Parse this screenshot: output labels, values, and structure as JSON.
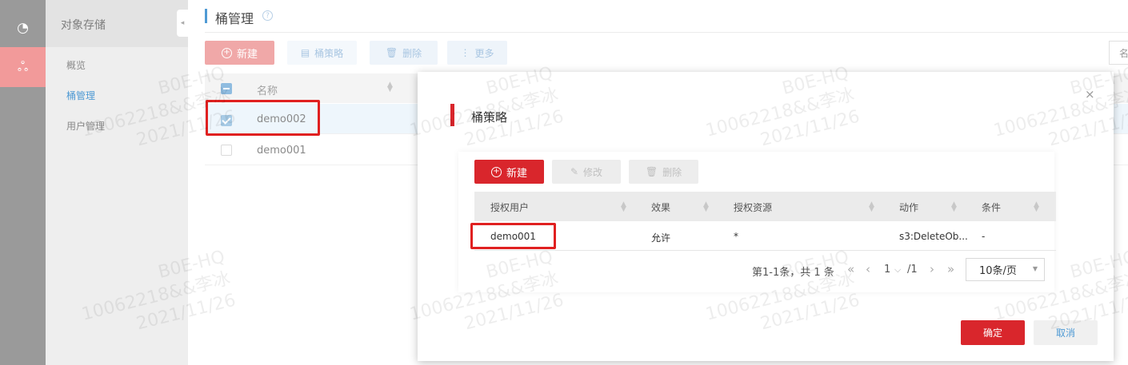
{
  "colors": {
    "rail_bg": "#9a9a9a",
    "rail_active": "#f29a9a",
    "sidebar_bg": "#eeeeee",
    "brand_red": "#d9262c",
    "link_blue": "#4f9ad4",
    "highlight_box": "#e02020"
  },
  "rail": {
    "items": [
      {
        "icon": "pie-chart-icon",
        "glyph": "◔"
      },
      {
        "icon": "storage-cluster-icon",
        "glyph": "ஃ"
      }
    ]
  },
  "sidebar": {
    "section_title": "对象存储",
    "collapse_glyph": "◂",
    "links": [
      {
        "label": "概览"
      },
      {
        "label": "桶管理"
      },
      {
        "label": "用户管理"
      }
    ]
  },
  "page": {
    "title": "桶管理",
    "help_glyph": "?",
    "toolbar": {
      "new_label": "新建",
      "policy_label": "桶策略",
      "delete_label": "删除",
      "more_label": "更多",
      "name_filter_label": "名"
    },
    "table": {
      "header_name": "名称",
      "rows": [
        {
          "name": "demo002",
          "checked": true
        },
        {
          "name": "demo001",
          "checked": false
        }
      ]
    }
  },
  "dialog": {
    "title": "桶策略",
    "close_glyph": "×",
    "toolbar": {
      "new_label": "新建",
      "edit_label": "修改",
      "delete_label": "删除"
    },
    "table": {
      "columns": [
        "授权用户",
        "效果",
        "授权资源",
        "动作",
        "条件"
      ],
      "rows": [
        {
          "user": "demo001",
          "effect": "允许",
          "resource": "*",
          "action": "s3:DeleteOb...",
          "condition": "-"
        }
      ]
    },
    "pagination": {
      "summary": "第1-1条，共 1 条",
      "current_page": "1",
      "total_pages": "/1",
      "page_size": "10条/页"
    },
    "ok_label": "确定",
    "cancel_label": "取消"
  },
  "watermark": {
    "line1": "B0E-HQ",
    "line2": "10062218&&李冰",
    "line3": "2021/11/26"
  }
}
